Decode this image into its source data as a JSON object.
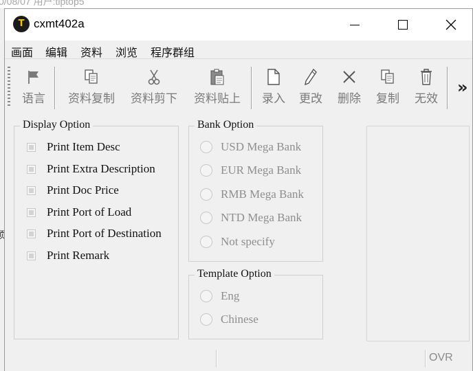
{
  "background_window": {
    "title_fragment": "0/08/07 用户:tiptop5",
    "side_fragment": "顷"
  },
  "window": {
    "title": "cxmt402a",
    "app_icon_letter": "T",
    "controls": {
      "minimize": "minimize",
      "maximize": "maximize",
      "close": "close"
    }
  },
  "menu": {
    "items": [
      "画面",
      "编辑",
      "资料",
      "浏览",
      "程序群组"
    ]
  },
  "toolbar": {
    "buttons": [
      {
        "label": "语言",
        "icon": "flag-icon"
      },
      {
        "label": "资料复制",
        "icon": "copy-data-icon"
      },
      {
        "label": "资料剪下",
        "icon": "scissors-icon"
      },
      {
        "label": "资料贴上",
        "icon": "clipboard-icon"
      },
      {
        "label": "录入",
        "icon": "new-document-icon"
      },
      {
        "label": "更改",
        "icon": "pencil-icon"
      },
      {
        "label": "删除",
        "icon": "x-icon"
      },
      {
        "label": "复制",
        "icon": "copy-icon"
      },
      {
        "label": "无效",
        "icon": "trash-icon"
      }
    ],
    "overflow": "»"
  },
  "display_option": {
    "legend": "Display Option",
    "items": [
      {
        "label": "Print Item Desc",
        "checked": false
      },
      {
        "label": "Print Extra Description",
        "checked": false
      },
      {
        "label": "Print Doc Price",
        "checked": false
      },
      {
        "label": "Print Port of Load",
        "checked": false
      },
      {
        "label": "Print Port of Destination",
        "checked": false
      },
      {
        "label": "Print Remark",
        "checked": false
      }
    ]
  },
  "bank_option": {
    "legend": "Bank Option",
    "items": [
      "USD Mega Bank",
      "EUR Mega Bank",
      "RMB Mega Bank",
      "NTD Mega Bank",
      "Not specify"
    ]
  },
  "template_option": {
    "legend": "Template Option",
    "items": [
      "Eng",
      "Chinese"
    ]
  },
  "status": {
    "mode": "OVR"
  },
  "colors": {
    "window_bg": "#f0f0f0",
    "disabled_text": "#8e8e8e",
    "icon_gold": "#f5c400"
  }
}
